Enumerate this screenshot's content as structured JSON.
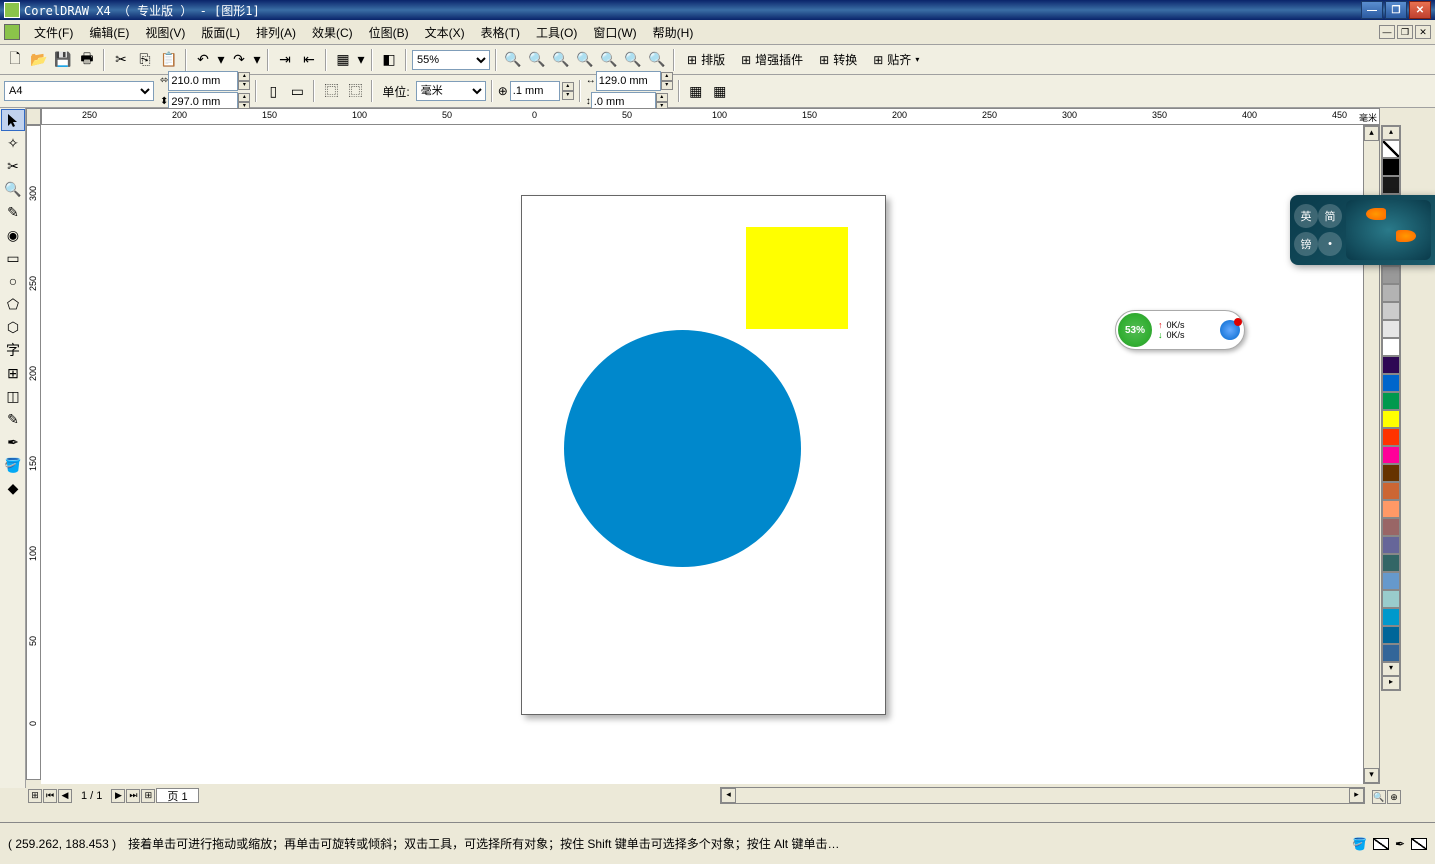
{
  "title": "CorelDRAW X4 （ 专业版 ） - [图形1]",
  "menu": [
    "文件(F)",
    "编辑(E)",
    "视图(V)",
    "版面(L)",
    "排列(A)",
    "效果(C)",
    "位图(B)",
    "文本(X)",
    "表格(T)",
    "工具(O)",
    "窗口(W)",
    "帮助(H)"
  ],
  "toolbar1": {
    "zoom": "55%",
    "btns": {
      "paiban": "排版",
      "zengqiang": "增强插件",
      "zhuanhuan": "转换",
      "tieqi": "贴齐"
    }
  },
  "property_bar": {
    "paper": "A4",
    "width": "210.0 mm",
    "height": "297.0 mm",
    "unit_label": "单位:",
    "unit_value": "毫米",
    "nudge": ".1 mm",
    "dup_x": "129.0 mm",
    "dup_y": ".0 mm"
  },
  "ruler": {
    "h": [
      "250",
      "200",
      "150",
      "100",
      "50",
      "0",
      "50",
      "100",
      "150",
      "200",
      "250",
      "300",
      "350",
      "400",
      "450"
    ],
    "v": [
      "300",
      "250",
      "200",
      "150",
      "100",
      "50",
      "0"
    ],
    "unit": "毫米"
  },
  "canvas": {
    "circle_color": "#0088cc",
    "square_color": "#ffff00"
  },
  "page_nav": {
    "current": "1 / 1",
    "tab": "页 1"
  },
  "status": {
    "coords": "( 259.262, 188.453 )",
    "hint": "接着单击可进行拖动或缩放；再单击可旋转或倾斜；双击工具，可选择所有对象；按住 Shift 键单击可选择多个对象；按住 Alt 键单击…"
  },
  "net_widget": {
    "pct": "53%",
    "up": "0K/s",
    "down": "0K/s"
  },
  "ime": {
    "b1": "英",
    "b2": "简",
    "b3": "镑"
  },
  "palette_colors": [
    "none",
    "#000000",
    "#333333",
    "#666666",
    "#999999",
    "#cccccc",
    "#ffffff",
    "#330066",
    "#003399",
    "#008800",
    "#ffff00",
    "#ff0000",
    "#ff00ff",
    "#cc6600",
    "#cc9966",
    "#cc99cc",
    "#999966",
    "#666666",
    "#336699",
    "#6699cc",
    "#996666",
    "#669999"
  ]
}
